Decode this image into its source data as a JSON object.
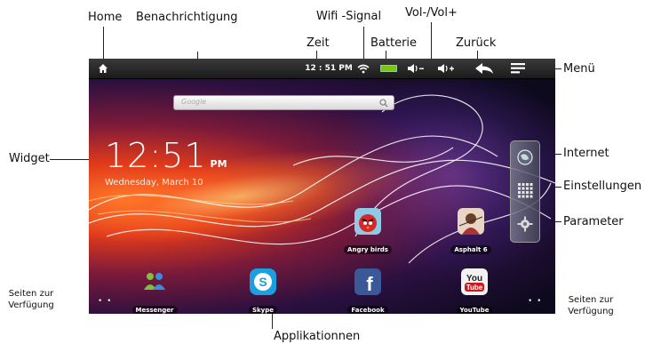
{
  "callouts": {
    "home": "Home",
    "benachrichtigung": "Benachrichtigung",
    "wifi_signal": "Wifi  -Signal",
    "vol": "Vol-/Vol+",
    "zeit": "Zeit",
    "batterie": "Batterie",
    "zurueck": "Zurück",
    "menue": "Menü",
    "widget": "Widget",
    "internet": "Internet",
    "einstellungen": "Einstellungen",
    "parameter": "Parameter",
    "seiten_left_1": "Seiten zur",
    "seiten_left_2": "Verfügung",
    "seiten_right_1": "Seiten zur",
    "seiten_right_2": "Verfügung",
    "applikationen": "Applikationnen"
  },
  "screen": {
    "status_time": "12 : 51 PM",
    "search_placeholder": "Google",
    "clock": {
      "time": "12:51",
      "ampm": "PM",
      "date": "Wednesday, March 10"
    },
    "apps_row": [
      {
        "label": "Angry birds",
        "icon": "angry-birds-icon"
      },
      {
        "label": "Asphalt 6",
        "icon": "asphalt-icon"
      }
    ],
    "dock": [
      {
        "label": "Messenger",
        "icon": "messenger-icon"
      },
      {
        "label": "Skype",
        "icon": "skype-icon"
      },
      {
        "label": "Facebook",
        "icon": "facebook-icon"
      },
      {
        "label": "YouTube",
        "icon": "youtube-icon"
      }
    ],
    "page_dots": "• •"
  },
  "colors": {
    "statusbar": "#1b1b1b",
    "battery": "#7ac70c",
    "skype": "#1a9fe0",
    "facebook": "#3b5998",
    "youtube": "#cc181e"
  }
}
